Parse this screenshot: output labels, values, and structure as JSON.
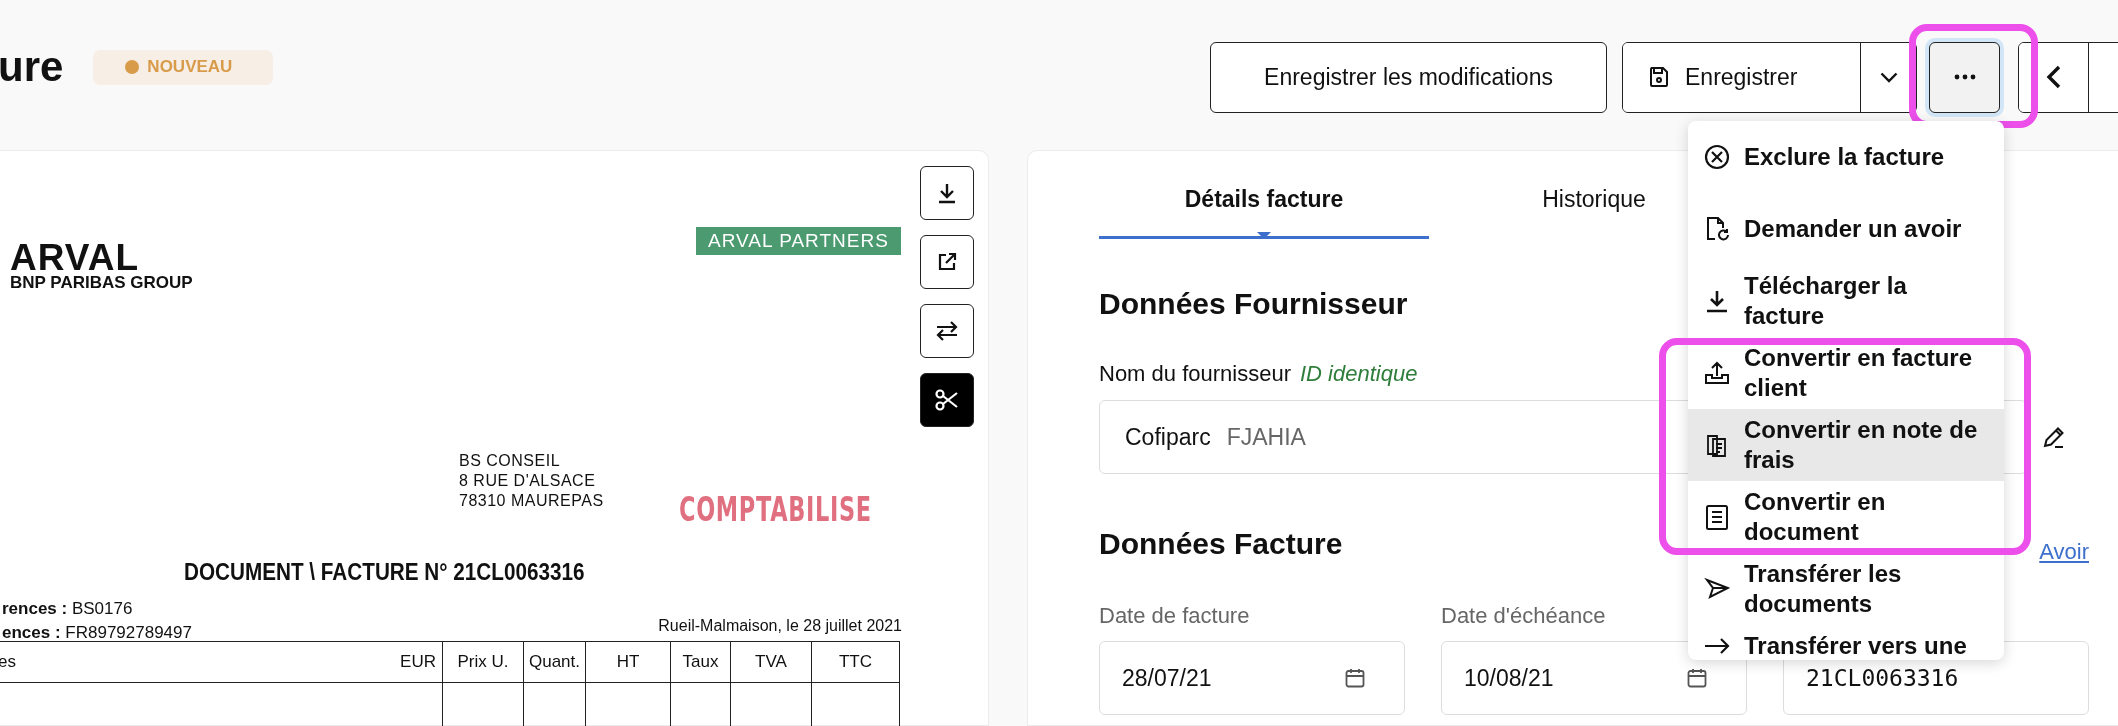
{
  "page": {
    "title": "ure",
    "status_badge": {
      "label": "NOUVEAU",
      "color": "#d89b4a"
    }
  },
  "toolbar": {
    "buttons": [
      {
        "kind": "text",
        "label": "Enregistrer les modifications"
      },
      {
        "kind": "split",
        "label": "Enregistrer"
      },
      {
        "kind": "more",
        "selected": true
      },
      {
        "kind": "nav"
      }
    ]
  },
  "document_preview": {
    "tools": [
      {
        "kind": "download",
        "selected": false
      },
      {
        "kind": "open-external",
        "selected": false
      },
      {
        "kind": "swap",
        "selected": false
      },
      {
        "kind": "scissors",
        "selected": true
      }
    ],
    "document": {
      "logo_name": "ARVAL",
      "logo_subtitle": "BNP PARIBAS GROUP",
      "partner_tag": "ARVAL PARTNERS",
      "recipient_address": [
        "BS CONSEIL",
        "8 RUE D'ALSACE",
        "78310 MAUREPAS"
      ],
      "stamp": "COMPTABILISE",
      "title": "DOCUMENT \\ FACTURE N° 21CL0063316",
      "references": [
        "**rences :** BS0176",
        "**ences :** FR89792789497"
      ],
      "place_date": "Rueil-Malmaison, le 28 juillet 2021",
      "table_columns": [
        "es",
        "EUR",
        "Prix U.",
        "Quant.",
        "HT",
        "Taux",
        "TVA",
        "TTC"
      ]
    }
  },
  "details": {
    "tabs": [
      {
        "label": "Détails facture",
        "selected": true
      },
      {
        "label": "Historique",
        "selected": false
      }
    ],
    "supplier_section": {
      "title": "Données Fournisseur",
      "field_label": "Nom du fournisseur",
      "match_note": "ID identique",
      "supplier_name": "Cofiparc",
      "supplier_code": "FJAHIA"
    },
    "invoice_section": {
      "title": "Données Facture",
      "link": "Avoir",
      "fields": [
        {
          "label": "Date de facture",
          "value": "28/07/21",
          "kind": "date"
        },
        {
          "label": "Date d'échéance",
          "value": "10/08/21",
          "kind": "date"
        },
        {
          "value": "21CL0063316",
          "kind": "text"
        }
      ]
    }
  },
  "more_menu": {
    "items": [
      {
        "kind": "exclude",
        "label": "Exclure la facture",
        "selected": false
      },
      {
        "kind": "request-credit",
        "label": "Demander un avoir",
        "selected": false
      },
      {
        "kind": "download",
        "label": "Télécharger la facture",
        "selected": false
      },
      {
        "kind": "convert-client",
        "label": "Convertir en facture client",
        "selected": false
      },
      {
        "kind": "convert-expense",
        "label": "Convertir en note de frais",
        "selected": true
      },
      {
        "kind": "convert-document",
        "label": "Convertir en document",
        "selected": false
      },
      {
        "kind": "transfer-documents",
        "label": "Transférer les documents",
        "selected": false
      },
      {
        "kind": "transfer-to",
        "label": "Transférer vers une",
        "selected": false
      }
    ]
  }
}
